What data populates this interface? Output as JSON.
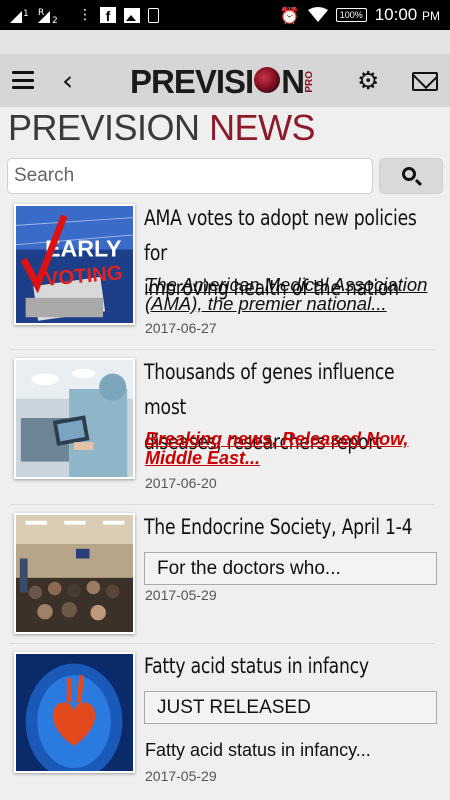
{
  "status_bar": {
    "time": "10:00",
    "time_suffix": "PM",
    "battery": "100%",
    "signal_labels": [
      "1",
      "R",
      "2"
    ]
  },
  "header": {
    "logo_text_left": "PREVISI",
    "logo_text_right": "N",
    "logo_pro": "PRO"
  },
  "page_title": {
    "part1": "PREVISION ",
    "part2": "NEWS"
  },
  "search": {
    "placeholder": "Search",
    "value": ""
  },
  "news": [
    {
      "title_line1": "AMA votes to adopt new policies for",
      "title_line2": "improving health of the nation",
      "summary_line1": "The American Medical Association",
      "summary_line2": "(AMA), the premier national...",
      "date": "2017-06-27",
      "thumb_text1": "EARLY",
      "thumb_text2": "VOTING"
    },
    {
      "title_line1": "Thousands of genes influence most",
      "title_line2": "diseases, researchers report",
      "summary_line1": "Breaking news, Released Now,",
      "summary_line2": "Middle East...",
      "date": "2017-06-20"
    },
    {
      "title_line1": "The Endocrine Society, April 1-4",
      "box_text": "For the doctors who...",
      "date": "2017-05-29"
    },
    {
      "title_line1": "Fatty acid status in infancy",
      "box_text": "JUST RELEASED",
      "plain_text": "Fatty acid status in infancy...",
      "date": "2017-05-29"
    }
  ],
  "colors": {
    "accent": "#8b1a2a",
    "breaking": "#cc0000",
    "header_bg": "#d6d6d6"
  },
  "icons": [
    "menu-icon",
    "back-icon",
    "settings-icon",
    "mail-icon",
    "search-icon"
  ]
}
